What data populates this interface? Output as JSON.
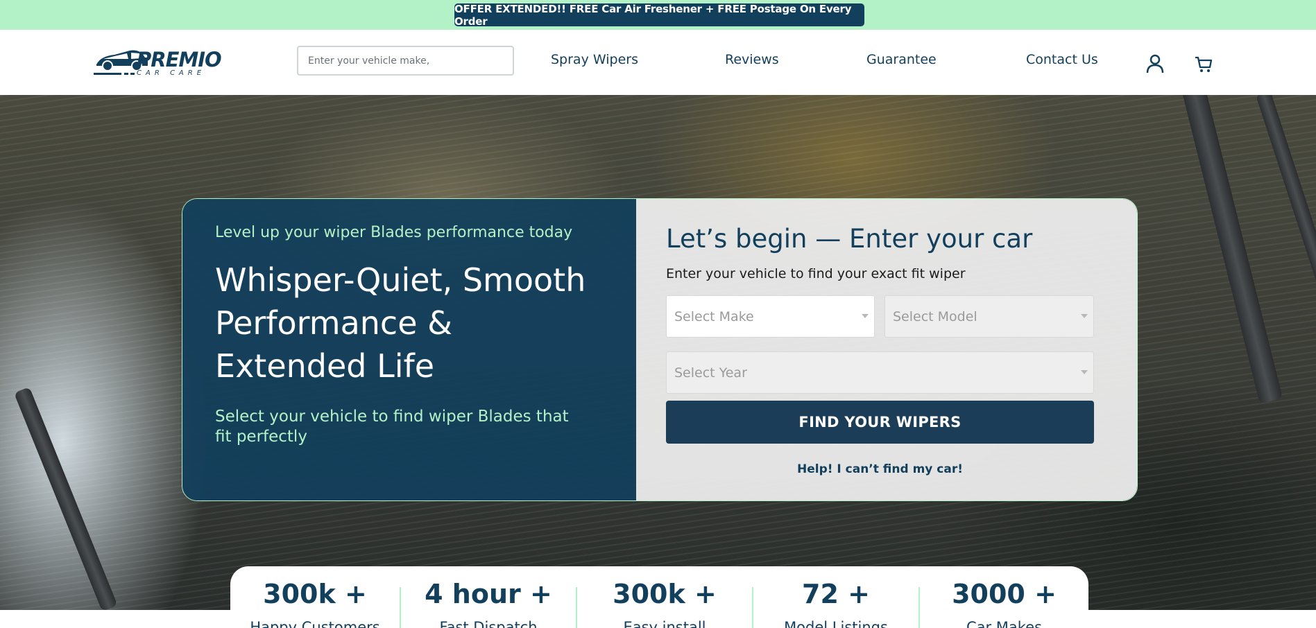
{
  "announcement": {
    "text": "OFFER EXTENDED!! FREE Car Air Freshener + FREE Postage On Every Order"
  },
  "header": {
    "logo_text": "PREMIO",
    "logo_subtext": "CAR CARE",
    "search_placeholder": "Enter your vehicle make,",
    "nav": [
      {
        "label": "Spray Wipers"
      },
      {
        "label": "Reviews"
      },
      {
        "label": "Guarantee"
      },
      {
        "label": "Contact Us"
      }
    ],
    "icons": [
      "account-icon",
      "cart-icon"
    ]
  },
  "hero": {
    "eyebrow": "Level up your wiper Blades performance today",
    "headline": "Whisper-Quiet, Smooth Performance & Extended Life",
    "subline": "Select your vehicle to find wiper Blades that fit perfectly",
    "form": {
      "title": "Let’s begin — Enter your car",
      "subtitle": "Enter your vehicle to find your exact fit wiper",
      "make_placeholder": "Select Make",
      "model_placeholder": "Select Model",
      "year_placeholder": "Select Year",
      "submit_label": "FIND YOUR WIPERS",
      "help_label": "Help! I can’t find my car!"
    }
  },
  "stats": [
    {
      "value": "300k +",
      "label": "Happy Customers"
    },
    {
      "value": "4 hour +",
      "label": "Fast Dispatch"
    },
    {
      "value": "300k +",
      "label": "Easy install"
    },
    {
      "value": "72 +",
      "label": "Model Listings"
    },
    {
      "value": "3000 +",
      "label": "Car Makes"
    }
  ],
  "colors": {
    "brand_navy": "#123f5c",
    "accent_mint": "#b3f1c6",
    "button_navy": "#1b3d58"
  }
}
